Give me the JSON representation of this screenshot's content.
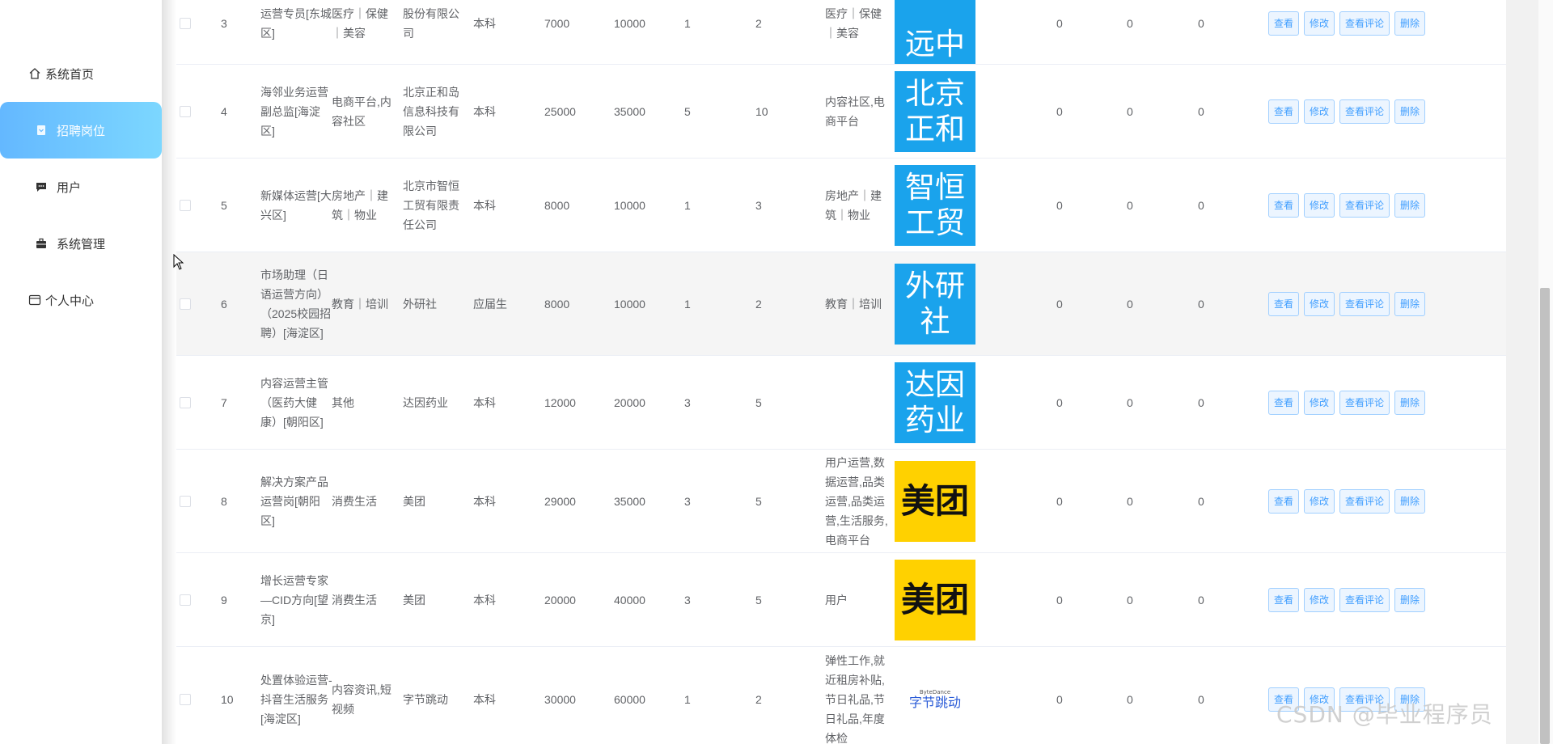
{
  "sidebar": {
    "items": [
      {
        "label": "系统首页",
        "icon": "home-icon"
      },
      {
        "label": "招聘岗位",
        "icon": "document-icon",
        "active": true
      },
      {
        "label": "用户",
        "icon": "chat-icon"
      },
      {
        "label": "系统管理",
        "icon": "briefcase-icon"
      },
      {
        "label": "个人中心",
        "icon": "card-icon"
      }
    ]
  },
  "table": {
    "rows": [
      {
        "idx": "3",
        "title": "运营专员[东城区]",
        "industry": "医疗｜保健｜美容",
        "company": "股份有限公司",
        "education": "本科",
        "salary_min": "7000",
        "salary_max": "10000",
        "experience": "1",
        "count": "2",
        "tags": "医疗｜保健｜美容",
        "logo_text": "远中",
        "n1": "0",
        "n2": "0",
        "n3": "0"
      },
      {
        "idx": "4",
        "title": "海邻业务运营副总监[海淀区]",
        "industry": "电商平台,内容社区",
        "company": "北京正和岛信息科技有限公司",
        "education": "本科",
        "salary_min": "25000",
        "salary_max": "35000",
        "experience": "5",
        "count": "10",
        "tags": "内容社区,电商平台",
        "logo_text": "北京正和",
        "n1": "0",
        "n2": "0",
        "n3": "0"
      },
      {
        "idx": "5",
        "title": "新媒体运营[大兴区]",
        "industry": "房地产｜建筑｜物业",
        "company": "北京市智恒工贸有限责任公司",
        "education": "本科",
        "salary_min": "8000",
        "salary_max": "10000",
        "experience": "1",
        "count": "3",
        "tags": "房地产｜建筑｜物业",
        "logo_text": "智恒工贸",
        "n1": "0",
        "n2": "0",
        "n3": "0"
      },
      {
        "idx": "6",
        "title": "市场助理（日语运营方向）（2025校园招聘）[海淀区]",
        "industry": "教育｜培训",
        "company": "外研社",
        "education": "应届生",
        "salary_min": "8000",
        "salary_max": "10000",
        "experience": "1",
        "count": "2",
        "tags": "教育｜培训",
        "logo_text": "外研社",
        "n1": "0",
        "n2": "0",
        "n3": "0"
      },
      {
        "idx": "7",
        "title": "内容运营主管（医药大健康）[朝阳区]",
        "industry": "其他",
        "company": "达因药业",
        "education": "本科",
        "salary_min": "12000",
        "salary_max": "20000",
        "experience": "3",
        "count": "5",
        "tags": "",
        "logo_text": "达因药业",
        "n1": "0",
        "n2": "0",
        "n3": "0"
      },
      {
        "idx": "8",
        "title": "解决方案产品运营岗[朝阳区]",
        "industry": "消费生活",
        "company": "美团",
        "education": "本科",
        "salary_min": "29000",
        "salary_max": "35000",
        "experience": "3",
        "count": "5",
        "tags": "用户运营,数据运营,品类运营,品类运营,生活服务,电商平台",
        "logo_text": "美团",
        "n1": "0",
        "n2": "0",
        "n3": "0"
      },
      {
        "idx": "9",
        "title": "增长运营专家—CID方向[望京]",
        "industry": "消费生活",
        "company": "美团",
        "education": "本科",
        "salary_min": "20000",
        "salary_max": "40000",
        "experience": "3",
        "count": "5",
        "tags": "用户",
        "logo_text": "美团",
        "n1": "0",
        "n2": "0",
        "n3": "0"
      },
      {
        "idx": "10",
        "title": "处置体验运营-抖音生活服务[海淀区]",
        "industry": "内容资讯,短视频",
        "company": "字节跳动",
        "education": "本科",
        "salary_min": "30000",
        "salary_max": "60000",
        "experience": "1",
        "count": "2",
        "tags": "弹性工作,就近租房补贴,节日礼品,节日礼品,年度体检",
        "logo_text": "字节跳动",
        "logo_small": "ByteDance",
        "n1": "0",
        "n2": "0",
        "n3": "0"
      }
    ],
    "actions": {
      "view": "查看",
      "edit": "修改",
      "comments": "查看评论",
      "delete": "删除"
    }
  },
  "watermark": "CSDN @毕业程序员",
  "colors": {
    "accent": "#409eff",
    "nav_active_start": "#64b8ff",
    "nav_active_end": "#7cd7ff",
    "logo_blue": "#1aa3ec",
    "logo_yellow": "#ffd100"
  }
}
